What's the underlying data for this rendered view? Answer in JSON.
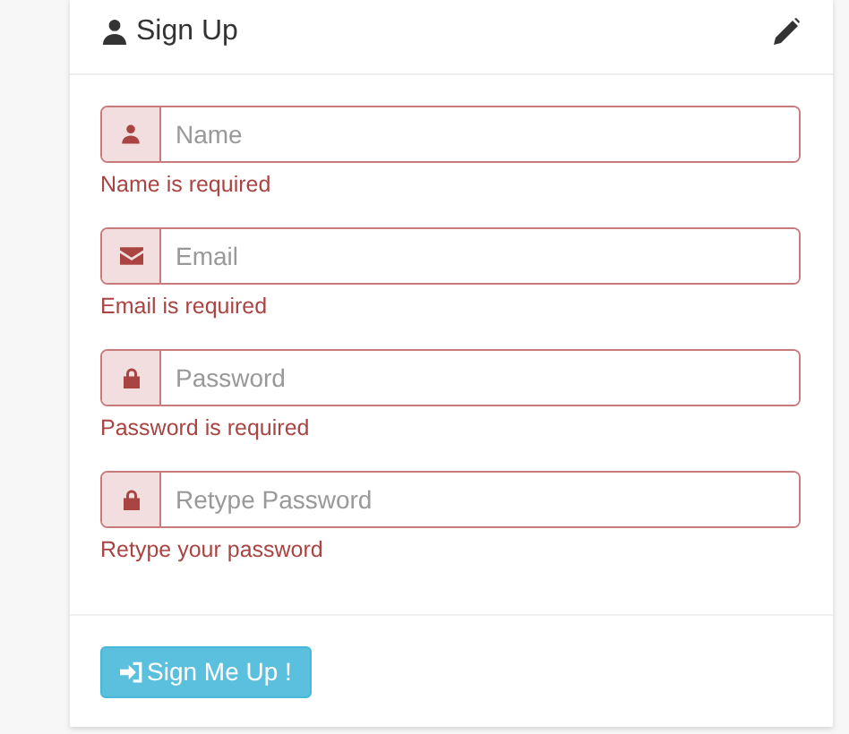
{
  "panel": {
    "title": "Sign Up"
  },
  "fields": [
    {
      "kind": "user",
      "placeholder": "Name",
      "error": "Name is required"
    },
    {
      "kind": "envelope",
      "placeholder": "Email",
      "error": "Email is required"
    },
    {
      "kind": "lock",
      "placeholder": "Password",
      "error": "Password is required"
    },
    {
      "kind": "lock",
      "placeholder": "Retype Password",
      "error": "Retype your password"
    }
  ],
  "submit": {
    "label": "Sign Me Up !"
  }
}
